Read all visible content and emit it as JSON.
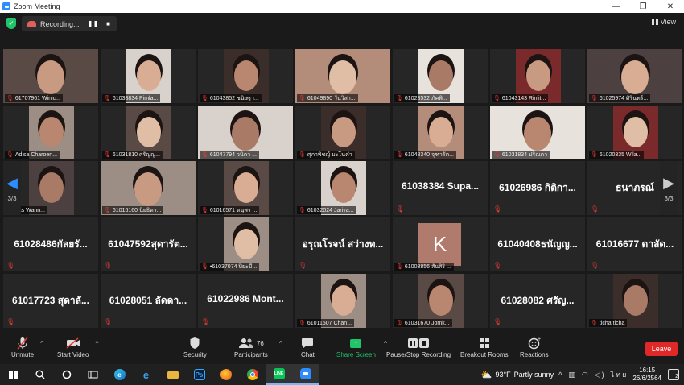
{
  "window": {
    "title": "Zoom Meeting",
    "minimize": "—",
    "maximize": "❐",
    "close": "✕"
  },
  "topbar": {
    "recording_label": "Recording...",
    "pause": "❚❚",
    "stop": "■",
    "view_label": "View"
  },
  "tiles": [
    {
      "name": "61707961 Winic...",
      "video": true
    },
    {
      "name": "61033834 Pimla...",
      "video": true
    },
    {
      "name": "61043852 ชนิษฐา...",
      "video": true
    },
    {
      "name": "61049890 วันวิสา...",
      "video": true
    },
    {
      "name": "61023532 ภัคพิ...",
      "video": true
    },
    {
      "name": "61043143 Rinlit...",
      "video": true
    },
    {
      "name": "61025974 ศิรินทร์...",
      "video": true
    },
    {
      "name": "Adisa Charoen...",
      "video": true
    },
    {
      "name": "61031810 ศรัญญ...",
      "video": true
    },
    {
      "name": "61047794 วนิดา ...",
      "video": true
    },
    {
      "name": "ศุภาพิชญ์ มะโนคำ",
      "video": true
    },
    {
      "name": "61048340 จุฑารัต...",
      "video": true
    },
    {
      "name": "61031834 ปริณดา",
      "video": true
    },
    {
      "name": "61020335 Wila...",
      "video": true
    },
    {
      "name": "pas Wann...",
      "video": true
    },
    {
      "name": "61016160 นิยธิดา...",
      "video": true
    },
    {
      "name": "61016571 ตนุพร ...",
      "video": true
    },
    {
      "name": "61032024 Jariya...",
      "video": true
    },
    {
      "name": "61038384  Supa...",
      "video": false
    },
    {
      "name": "61026986 กิติกา...",
      "video": false
    },
    {
      "name": "ธนาภรณ์",
      "video": false
    },
    {
      "name": "61028486กัลยรั...",
      "video": false
    },
    {
      "name": "61047592สุดารัต...",
      "video": false
    },
    {
      "name": "•61037074 ปิยะมี...",
      "video": true
    },
    {
      "name": "อรุณโรจน์ สว่างท...",
      "video": false
    },
    {
      "name": "61003856 สันสิริ ...",
      "video": false,
      "avatar": "K"
    },
    {
      "name": "61040408ธนัญญ...",
      "video": false
    },
    {
      "name": "61016677 ดาลัด...",
      "video": false
    },
    {
      "name": "61017723 สุดาลั...",
      "video": false
    },
    {
      "name": "61028051 ลัดดา...",
      "video": false
    },
    {
      "name": "61022986  Mont...",
      "video": false
    },
    {
      "name": "61011507 Chan...",
      "video": true
    },
    {
      "name": "61031670 Jomk...",
      "video": true
    },
    {
      "name": "61028082 ศรัญ...",
      "video": false
    },
    {
      "name": "ticha ticha",
      "video": true
    }
  ],
  "pager": {
    "left_page": "3/3",
    "right_page": "3/3"
  },
  "toolbar": {
    "unmute": "Unmute",
    "start_video": "Start Video",
    "security": "Security",
    "participants": "Participants",
    "participants_count": "76",
    "chat": "Chat",
    "share_screen": "Share Screen",
    "pause_recording": "Pause/Stop Recording",
    "breakout_rooms": "Breakout Rooms",
    "reactions": "Reactions",
    "leave": "Leave"
  },
  "taskbar": {
    "weather_temp": "93°F",
    "weather_desc": "Partly sunny",
    "lang": "ไทย",
    "time": "16:15",
    "date": "26/6/2564",
    "notifications": "2"
  },
  "colors": {
    "accent": "#2d8cff",
    "muted_red": "#e53935",
    "share_green": "#21c46a",
    "leave_red": "#e02828"
  }
}
